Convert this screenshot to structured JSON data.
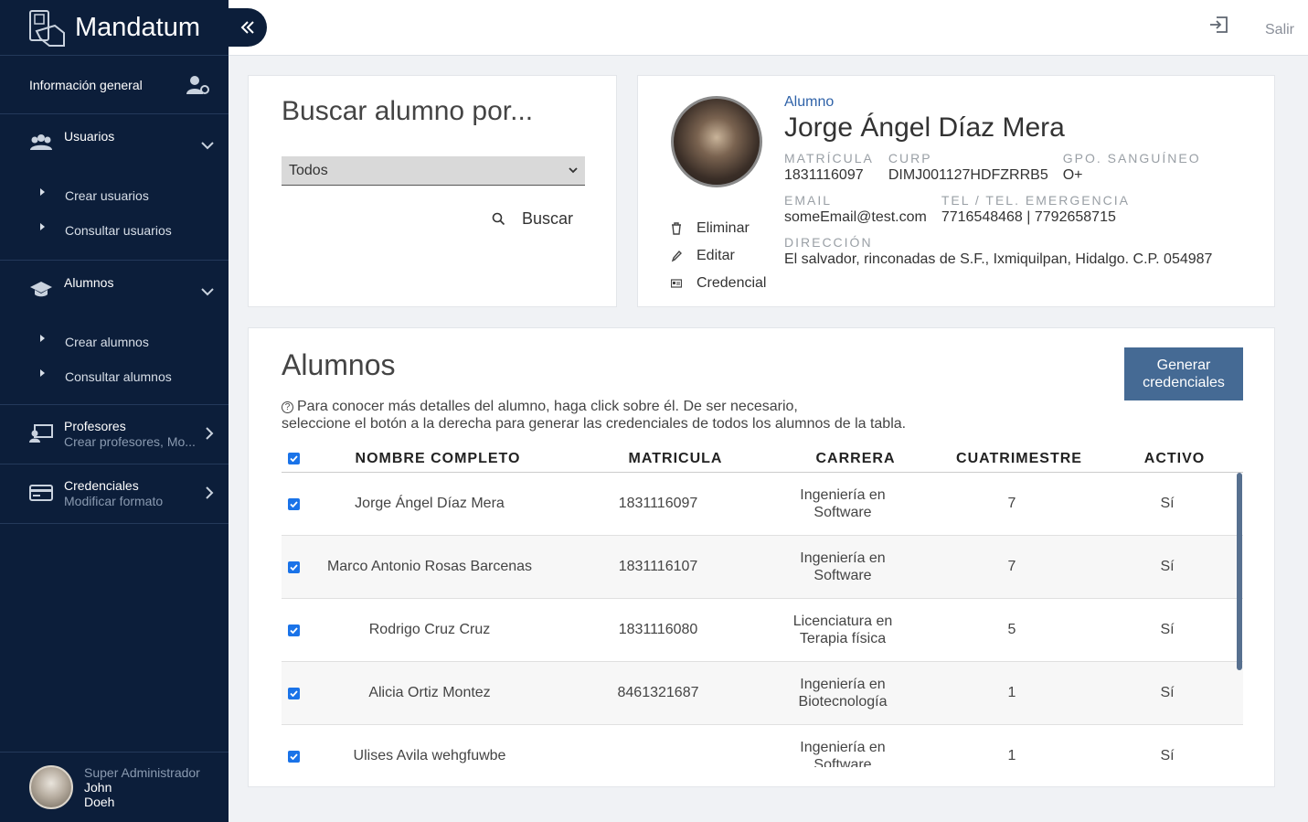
{
  "app": {
    "name": "Mandatum"
  },
  "sidebar": {
    "info_label": "Información general",
    "sections": [
      {
        "title": "Usuarios",
        "subtitle": "",
        "items": [
          "Crear usuarios",
          "Consultar usuarios"
        ]
      },
      {
        "title": "Alumnos",
        "subtitle": "",
        "items": [
          "Crear alumnos",
          "Consultar alumnos"
        ]
      },
      {
        "title": "Profesores",
        "subtitle": "Crear profesores, Mo..."
      },
      {
        "title": "Credenciales",
        "subtitle": "Modificar formato"
      }
    ],
    "user": {
      "role": "Super Administrador",
      "first": "John",
      "last": "Doeh"
    }
  },
  "topbar": {
    "logout": "Salir"
  },
  "search": {
    "title": "Buscar alumno por...",
    "select_value": "Todos",
    "button": "Buscar"
  },
  "student": {
    "kind": "Alumno",
    "name": "Jorge Ángel Díaz Mera",
    "matricula_label": "MATRÍCULA",
    "matricula": "1831116097",
    "curp_label": "CURP",
    "curp": "DIMJ001127HDFZRRB5",
    "blood_label": "GPO. SANGUÍNEO",
    "blood": "O+",
    "email_label": "EMAIL",
    "email": "someEmail@test.com",
    "tel_label": "TEL / TEL. EMERGENCIA",
    "tel": "7716548468 | 7792658715",
    "address_label": "DIRECCIÓN",
    "address": "El salvador, rinconadas de S.F., Ixmiquilpan, Hidalgo. C.P. 054987",
    "actions": {
      "delete": "Eliminar",
      "edit": "Editar",
      "credential": "Credencial"
    }
  },
  "table": {
    "title": "Alumnos",
    "generate_button": "Generar credenciales",
    "hint_line1": "Para conocer más detalles del alumno, haga click sobre él. De ser necesario,",
    "hint_line2": "seleccione el botón a la derecha para generar las credenciales de todos los alumnos de la tabla.",
    "headers": {
      "name": "NOMBRE COMPLETO",
      "matricula": "MATRICULA",
      "carrera": "CARRERA",
      "cuatrimestre": "CUATRIMESTRE",
      "activo": "ACTIVO"
    },
    "rows": [
      {
        "name": "Jorge Ángel Díaz Mera",
        "matricula": "1831116097",
        "carrera1": "Ingeniería en",
        "carrera2": "Software",
        "cuatrimestre": "7",
        "activo": "Sí"
      },
      {
        "name": "Marco Antonio Rosas Barcenas",
        "matricula": "1831116107",
        "carrera1": "Ingeniería en",
        "carrera2": "Software",
        "cuatrimestre": "7",
        "activo": "Sí"
      },
      {
        "name": "Rodrigo Cruz Cruz",
        "matricula": "1831116080",
        "carrera1": "Licenciatura en",
        "carrera2": "Terapia física",
        "cuatrimestre": "5",
        "activo": "Sí"
      },
      {
        "name": "Alicia Ortiz Montez",
        "matricula": "8461321687",
        "carrera1": "Ingeniería en",
        "carrera2": "Biotecnología",
        "cuatrimestre": "1",
        "activo": "Sí"
      },
      {
        "name": "Ulises Avila wehgfuwbe",
        "matricula": "",
        "carrera1": "Ingeniería en",
        "carrera2": "Software",
        "cuatrimestre": "1",
        "activo": "Sí"
      }
    ]
  },
  "colors": {
    "sidebar": "#0c1e3a",
    "accent": "#456a94",
    "link": "#2f62a8",
    "checkbox": "#1a73e8"
  }
}
